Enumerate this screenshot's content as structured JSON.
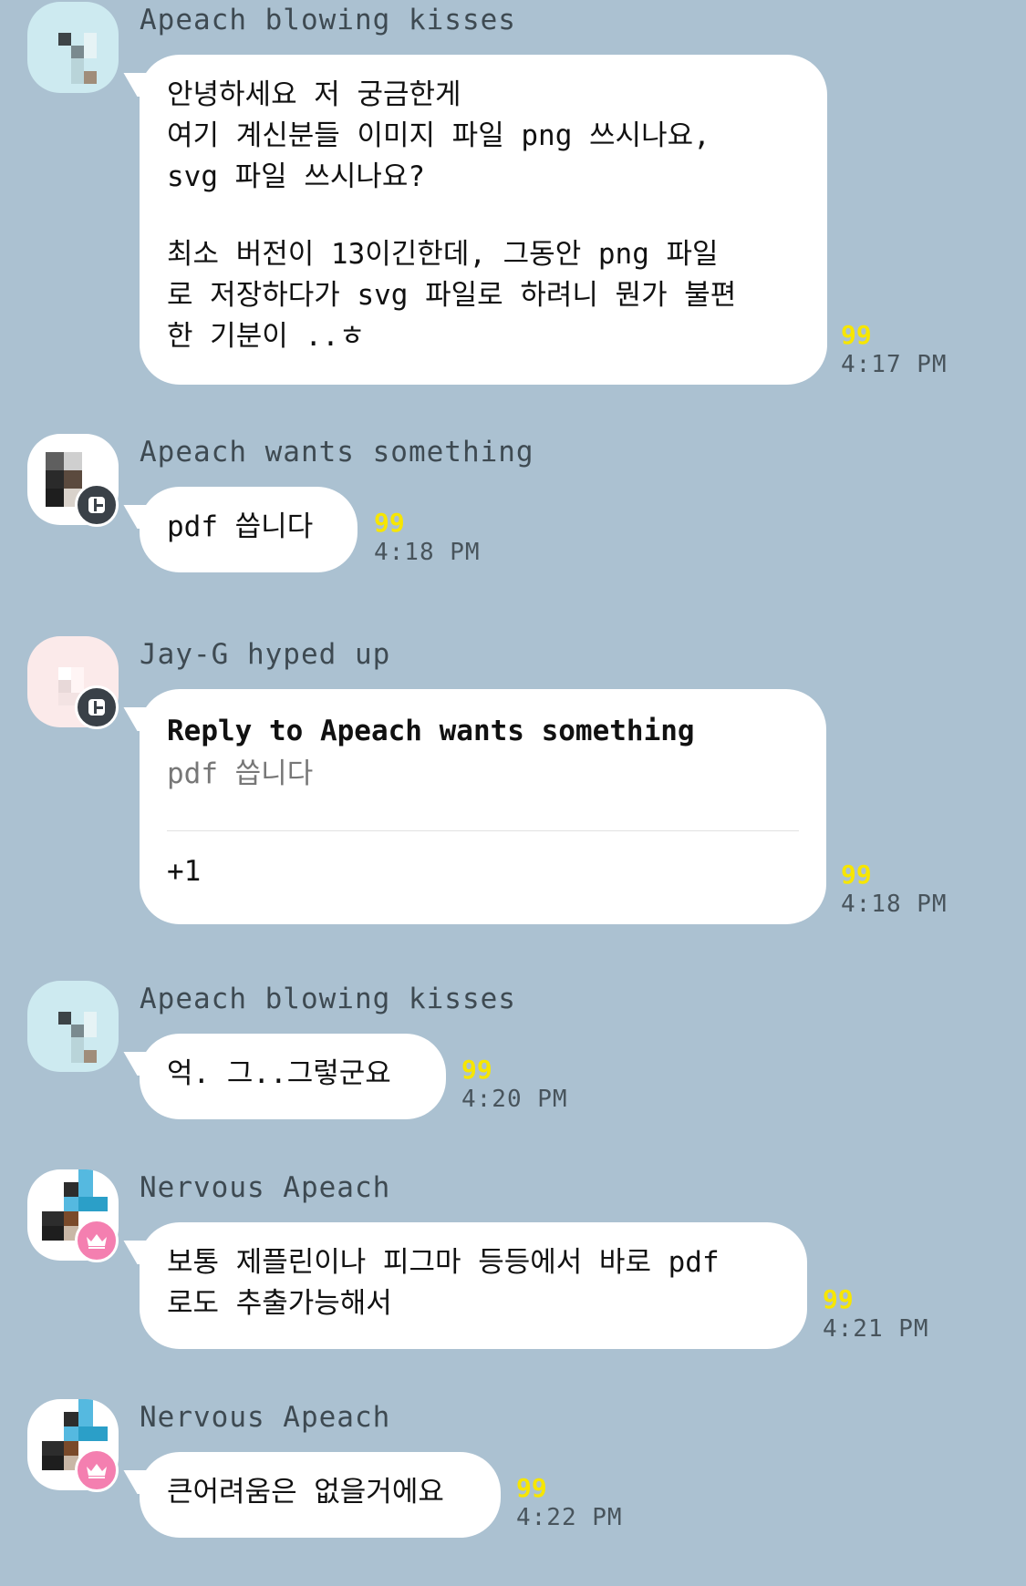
{
  "messages": [
    {
      "sender": "Apeach blowing kisses",
      "lines": [
        "안녕하세요 저 궁금한게",
        "여기 계신분들 이미지 파일 png 쓰시나요,",
        "svg 파일 쓰시나요?",
        "",
        "최소 버전이 13이긴한데, 그동안 png 파일",
        "로 저장하다가 svg 파일로 하려니 뭔가 불편",
        "한 기분이 ..ㅎ"
      ],
      "count": "99",
      "time": "4:17 PM",
      "avatar_icon": "apeach-avatar-mint"
    },
    {
      "sender": "Apeach wants something",
      "lines": [
        "pdf 씁니다"
      ],
      "count": "99",
      "time": "4:18 PM",
      "avatar_icon": "apeach-avatar-dark",
      "badge_icon": "manager-badge-icon"
    },
    {
      "sender": "Jay-G hyped up",
      "reply": {
        "title": "Reply to Apeach wants something",
        "quote": "pdf 씁니다"
      },
      "lines": [
        "+1"
      ],
      "count": "99",
      "time": "4:18 PM",
      "avatar_icon": "jayg-avatar-pink",
      "badge_icon": "manager-badge-icon"
    },
    {
      "sender": "Apeach blowing kisses",
      "lines": [
        "억. 그..그렇군요"
      ],
      "count": "99",
      "time": "4:20 PM",
      "avatar_icon": "apeach-avatar-mint"
    },
    {
      "sender": "Nervous Apeach",
      "lines": [
        "보통 제플린이나 피그마 등등에서 바로 pdf",
        "로도 추출가능해서"
      ],
      "count": "99",
      "time": "4:21 PM",
      "avatar_icon": "apeach-avatar-blue",
      "badge_icon": "crown-badge-icon"
    },
    {
      "sender": "Nervous Apeach",
      "lines": [
        "큰어려움은 없을거에요"
      ],
      "count": "99",
      "time": "4:22 PM",
      "avatar_icon": "apeach-avatar-blue",
      "badge_icon": "crown-badge-icon"
    }
  ]
}
